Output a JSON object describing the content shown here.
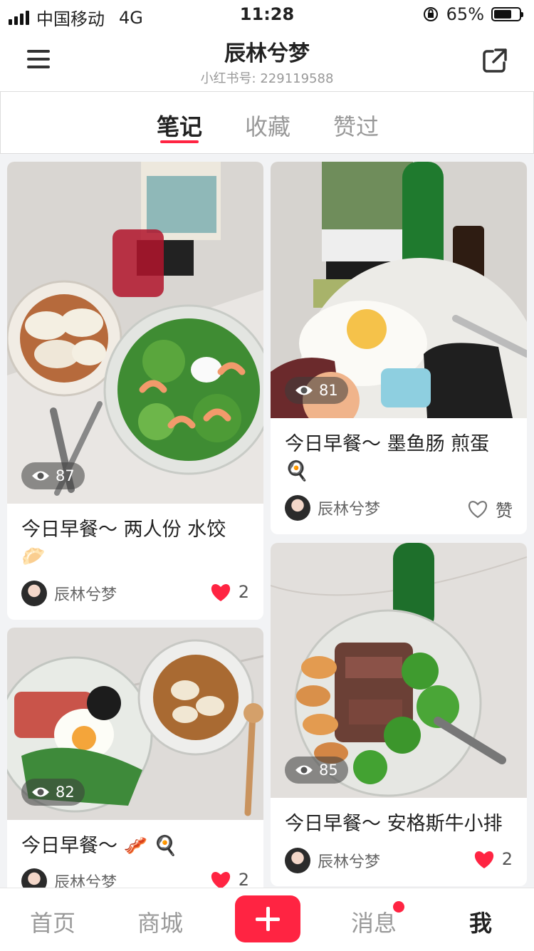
{
  "status": {
    "carrier": "中国移动",
    "network": "4G",
    "time": "11:28",
    "battery": "65%"
  },
  "header": {
    "title": "辰林兮梦",
    "subtitle": "小红书号: 229119588"
  },
  "tabs": [
    {
      "label": "笔记"
    },
    {
      "label": "收藏"
    },
    {
      "label": "赞过"
    }
  ],
  "notes": [
    {
      "title": "今日早餐～ 两人份 水饺",
      "emoji": "🥟",
      "views": "87",
      "author": "辰林兮梦",
      "likes": "2"
    },
    {
      "title": "今日早餐～ 墨鱼肠 煎蛋",
      "emoji": "🍳",
      "views": "81",
      "author": "辰林兮梦",
      "likes": "赞"
    },
    {
      "title": "今日早餐～ 🥓 🍳",
      "views": "82",
      "author": "辰林兮梦",
      "likes": "2"
    },
    {
      "title": "今日早餐～ 安格斯牛小排",
      "views": "85",
      "author": "辰林兮梦",
      "likes": "2"
    }
  ],
  "bottom_nav": [
    {
      "label": "首页"
    },
    {
      "label": "商城"
    },
    {
      "label": "消息"
    },
    {
      "label": "我"
    }
  ],
  "colors": {
    "accent": "#ff2442",
    "background": "#f2f3f5"
  }
}
